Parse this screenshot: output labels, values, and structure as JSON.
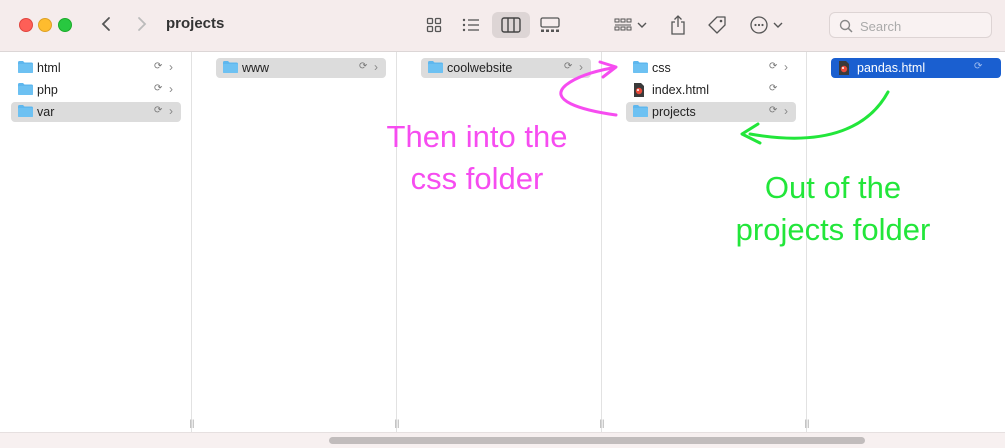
{
  "window": {
    "title": "projects"
  },
  "toolbar": {
    "search_placeholder": "Search"
  },
  "columns": [
    {
      "items": [
        {
          "label": "html",
          "type": "folder"
        },
        {
          "label": "php",
          "type": "folder"
        },
        {
          "label": "var",
          "type": "folder"
        }
      ]
    },
    {
      "items": [
        {
          "label": "www",
          "type": "folder"
        }
      ]
    },
    {
      "items": [
        {
          "label": "coolwebsite",
          "type": "folder"
        }
      ]
    },
    {
      "items": [
        {
          "label": "css",
          "type": "folder"
        },
        {
          "label": "index.html",
          "type": "file"
        },
        {
          "label": "projects",
          "type": "folder"
        }
      ]
    },
    {
      "items": [
        {
          "label": "pandas.html",
          "type": "file"
        }
      ]
    }
  ],
  "annotations": {
    "pink_line1": "Then into the",
    "pink_line2": "css folder",
    "green_line1": "Out of the",
    "green_line2": "projects folder"
  },
  "colors": {
    "pink": "#f64cf0",
    "green": "#22e63a",
    "selection_blue": "#1a5fd0",
    "folder_blue": "#5eb7ee"
  }
}
